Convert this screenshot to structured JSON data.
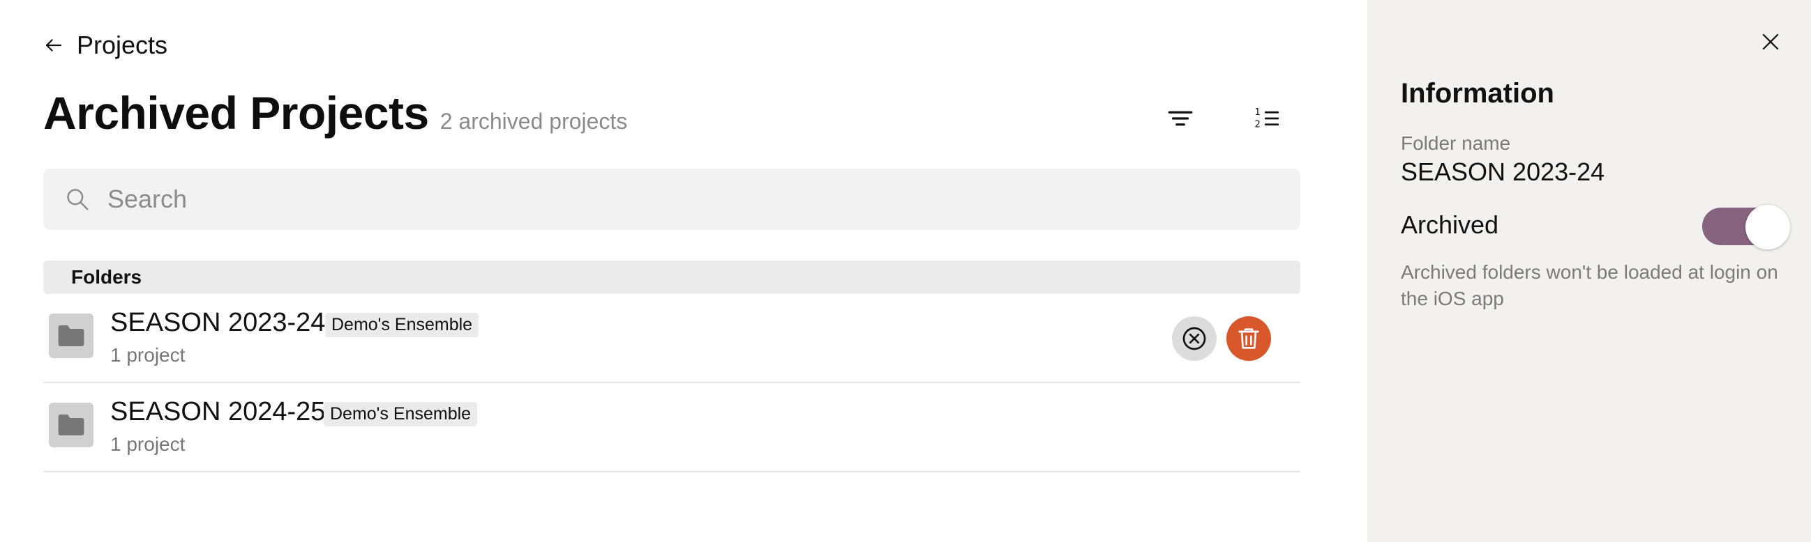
{
  "header": {
    "back_label": "Projects",
    "title": "Archived Projects",
    "subtitle": "2 archived projects"
  },
  "toolbar": {
    "filter_icon": "filter-lines-icon",
    "sort_icon": "numbered-list-icon"
  },
  "search": {
    "placeholder": "Search",
    "value": ""
  },
  "section": {
    "label": "Folders"
  },
  "folders": [
    {
      "name": "SEASON 2023-24",
      "badge": "Demo's Ensemble",
      "meta": "1 project"
    },
    {
      "name": "SEASON 2024-25",
      "badge": "Demo's Ensemble",
      "meta": "1 project"
    }
  ],
  "panel": {
    "title": "Information",
    "folder_name_label": "Folder name",
    "folder_name_value": "SEASON 2023-24",
    "archived_label": "Archived",
    "archived_on": true,
    "help_text": "Archived folders won't be loaded at login on the iOS app"
  },
  "colors": {
    "accent_toggle": "#86637e",
    "delete_button": "#d9582b",
    "panel_background": "#f2f1ef"
  }
}
